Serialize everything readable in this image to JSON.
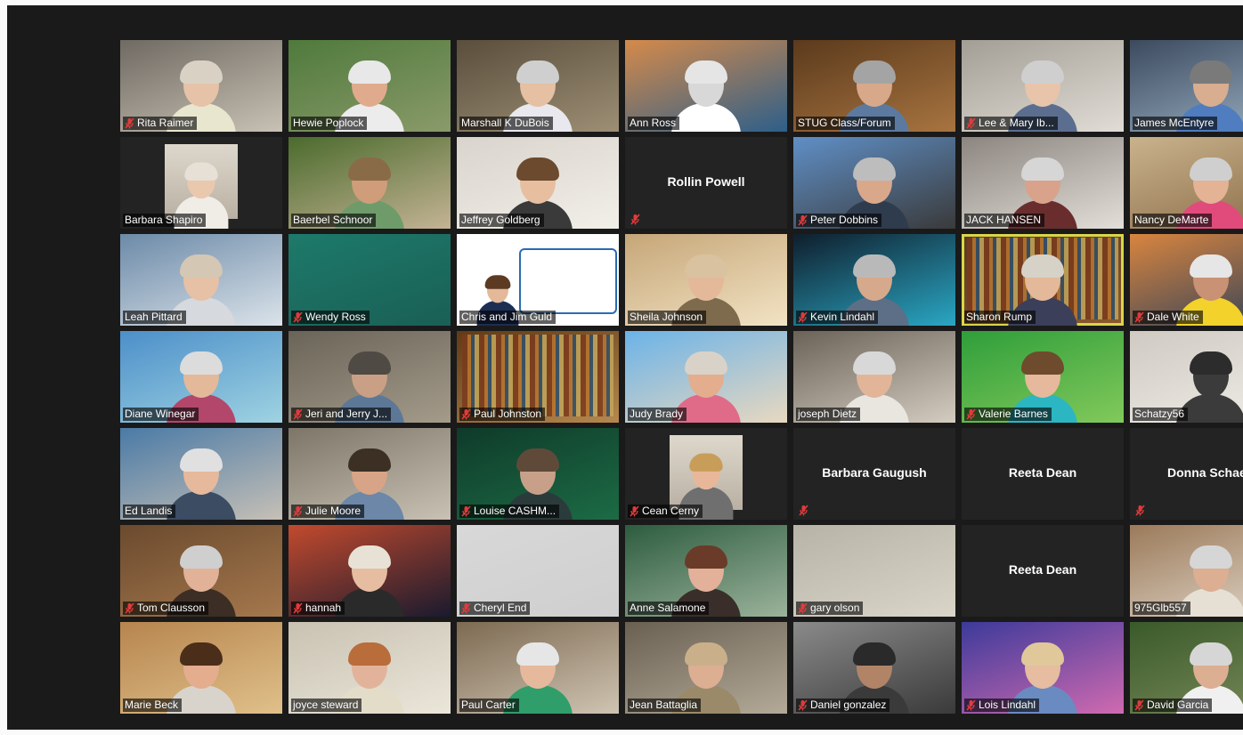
{
  "meeting": {
    "participants": [
      {
        "name": "Rita Raimer",
        "muted": true,
        "video": true,
        "c1": "#6f6a62",
        "c2": "#c8c1b4",
        "skin": "#e6c3a8",
        "hair": "#d9d2c4",
        "shirt": "#e9e6cf"
      },
      {
        "name": "Hewie Poplock",
        "muted": false,
        "video": true,
        "c1": "#4f7a3c",
        "c2": "#8a9a6a",
        "skin": "#e0ab8c",
        "hair": "#e8e8e8",
        "shirt": "#ececec"
      },
      {
        "name": "Marshall K DuBois",
        "muted": false,
        "video": true,
        "c1": "#5a4e3c",
        "c2": "#9d8f75",
        "skin": "#e5c0a2",
        "hair": "#cfcfcf",
        "shirt": "#e8e8ee"
      },
      {
        "name": "Ann Ross",
        "muted": false,
        "video": true,
        "c1": "#d58a4a",
        "c2": "#2d5f8a",
        "skin": "#d8d8d8",
        "hair": "#e5e5e5",
        "shirt": "#ffffff"
      },
      {
        "name": "STUG Class/Forum",
        "muted": false,
        "video": true,
        "c1": "#5b3a1c",
        "c2": "#a87440",
        "skin": "#d7a98a",
        "hair": "#a4a4a4",
        "shirt": "#5c7aa0"
      },
      {
        "name": "Lee & Mary Ib...",
        "muted": true,
        "video": true,
        "c1": "#a39e95",
        "c2": "#e1ddd6",
        "skin": "#e8c4aa",
        "hair": "#cfcfcf",
        "shirt": "#5b6e90"
      },
      {
        "name": "James McEntyre",
        "muted": false,
        "video": true,
        "c1": "#3c4a5e",
        "c2": "#9ab0c4",
        "skin": "#d9ad8f",
        "hair": "#7a7a7a",
        "shirt": "#4f7dbf"
      },
      {
        "name": "Barbara Shapiro",
        "muted": false,
        "video": false,
        "photo": true,
        "skin": "#e9c8ae",
        "hair": "#e6e0d6",
        "shirt": "#f0ece6"
      },
      {
        "name": "Baerbel Schnoor",
        "muted": false,
        "video": true,
        "c1": "#4b6b2d",
        "c2": "#c4b394",
        "skin": "#cf9d7a",
        "hair": "#8a6b48",
        "shirt": "#6f9b6b"
      },
      {
        "name": "Jeffrey Goldberg",
        "muted": false,
        "video": true,
        "c1": "#d9d4cc",
        "c2": "#f2efe9",
        "skin": "#e7be9f",
        "hair": "#6b4a2e",
        "shirt": "#3a3a3a"
      },
      {
        "name": "Rollin Powell",
        "muted": true,
        "video": false
      },
      {
        "name": "Peter Dobbins",
        "muted": true,
        "video": true,
        "c1": "#5f8fc6",
        "c2": "#3a3a3a",
        "skin": "#d9a88a",
        "hair": "#bdbdbd",
        "shirt": "#2f3c4e"
      },
      {
        "name": "JACK HANSEN",
        "muted": false,
        "video": true,
        "c1": "#8c8580",
        "c2": "#e3dfd8",
        "skin": "#d9a28a",
        "hair": "#d6d6d6",
        "shirt": "#6a2d2d"
      },
      {
        "name": "Nancy DeMarte",
        "muted": false,
        "video": true,
        "c1": "#c9b38c",
        "c2": "#8a6b48",
        "skin": "#e4b295",
        "hair": "#cfcfcf",
        "shirt": "#e04b7b"
      },
      {
        "name": "Leah Pittard",
        "muted": false,
        "video": true,
        "c1": "#6c8aa8",
        "c2": "#dbe3ea",
        "skin": "#e6c1a6",
        "hair": "#d4c7b4",
        "shirt": "#d6d9dd"
      },
      {
        "name": "Wendy Ross",
        "muted": true,
        "video": true,
        "c1": "#1d7a6a",
        "c2": "#1a5f56",
        "skin": "#1d7a6a",
        "hair": "#1d7a6a",
        "shirt": "#1d7a6a",
        "empty": true
      },
      {
        "name": "Chris and Jim  Guld",
        "muted": false,
        "video": true,
        "slide": true,
        "skin": "#e3b99a",
        "hair": "#5c3b22",
        "shirt": "#1d2e54"
      },
      {
        "name": "Sheila Johnson",
        "muted": false,
        "video": true,
        "c1": "#c6a678",
        "c2": "#f2e3c4",
        "skin": "#e3b99a",
        "hair": "#d9c2a0",
        "shirt": "#7e6a4c"
      },
      {
        "name": "Kevin Lindahl",
        "muted": true,
        "video": true,
        "c1": "#0f1e2c",
        "c2": "#2aa7c4",
        "skin": "#d6a98c",
        "hair": "#b9b9b9",
        "shirt": "#5c6f86"
      },
      {
        "name": "Sharon Rump",
        "muted": false,
        "video": true,
        "active": true,
        "bookshelf": true,
        "c1": "#5a3a1f",
        "c2": "#8c5a2e",
        "skin": "#e3b99a",
        "hair": "#d7d2c8",
        "shirt": "#3c3f59"
      },
      {
        "name": "Dale White",
        "muted": true,
        "video": true,
        "c1": "#d9853f",
        "c2": "#2b3f5a",
        "skin": "#c99274",
        "hair": "#e6e6e6",
        "shirt": "#f2d22b"
      },
      {
        "name": "Diane Winegar",
        "muted": false,
        "video": true,
        "c1": "#4c8fc9",
        "c2": "#9fd3e2",
        "skin": "#e3b99a",
        "hair": "#dcdcdc",
        "shirt": "#b2476b"
      },
      {
        "name": "Jeri and Jerry J...",
        "muted": true,
        "video": true,
        "c1": "#6a6458",
        "c2": "#a49b8a",
        "skin": "#c9a086",
        "hair": "#4f4a44",
        "shirt": "#5d7897"
      },
      {
        "name": "Paul Johnston",
        "muted": true,
        "video": true,
        "bookshelf": true,
        "c1": "#5f3a16",
        "c2": "#b5884e",
        "skin": "#a47d5e",
        "hair": "#5f3a16",
        "shirt": "#5f3a16",
        "empty": true
      },
      {
        "name": "Judy Brady",
        "muted": false,
        "video": true,
        "c1": "#6bb3e8",
        "c2": "#e8d8c0",
        "skin": "#e3ad8e",
        "hair": "#d9d2c8",
        "shirt": "#e06b89"
      },
      {
        "name": "joseph Dietz",
        "muted": false,
        "video": true,
        "c1": "#6b6358",
        "c2": "#d4ccc0",
        "skin": "#e2b599",
        "hair": "#d8d8d8",
        "shirt": "#e9e6e0"
      },
      {
        "name": "Valerie Barnes",
        "muted": true,
        "video": true,
        "c1": "#2f9e3a",
        "c2": "#82c95b",
        "skin": "#e6b99c",
        "hair": "#6e4b2c",
        "shirt": "#2bb6c2"
      },
      {
        "name": "Schatzy56",
        "muted": false,
        "video": true,
        "c1": "#cfcac2",
        "c2": "#f0ede8",
        "skin": "#3b3b3b",
        "hair": "#2c2c2c",
        "shirt": "#3b3b3b"
      },
      {
        "name": "Ed Landis",
        "muted": false,
        "video": true,
        "c1": "#4a7aa6",
        "c2": "#c6c0b6",
        "skin": "#e6b99c",
        "hair": "#e0e0e0",
        "shirt": "#3b4c63"
      },
      {
        "name": "Julie Moore",
        "muted": true,
        "video": true,
        "c1": "#7d7668",
        "c2": "#c9c2b4",
        "skin": "#d7a487",
        "hair": "#3c3025",
        "shirt": "#6c87a8"
      },
      {
        "name": "Louise CASHM...",
        "muted": true,
        "video": true,
        "c1": "#0f3b2a",
        "c2": "#1c6b45",
        "skin": "#c8a08a",
        "hair": "#5f4a3a",
        "shirt": "#2b3b3b"
      },
      {
        "name": "Cean Cerny",
        "muted": true,
        "video": false,
        "photo": true,
        "skin": "#e8b79a",
        "hair": "#c79d59",
        "shirt": "#6f6f6f"
      },
      {
        "name": "Barbara Gaugush",
        "muted": true,
        "video": false
      },
      {
        "name": "Reeta Dean",
        "muted": false,
        "video": false
      },
      {
        "name": "Donna Schaeff",
        "muted": true,
        "video": false
      },
      {
        "name": "Tom Clausson",
        "muted": true,
        "video": true,
        "c1": "#6b4a2e",
        "c2": "#a5784d",
        "skin": "#e2b298",
        "hair": "#cfcfcf",
        "shirt": "#3c2e24"
      },
      {
        "name": "hannah",
        "muted": true,
        "video": true,
        "c1": "#c24a2e",
        "c2": "#1a1a2e",
        "skin": "#e6bda0",
        "hair": "#e8e2d6",
        "shirt": "#2a2a2a"
      },
      {
        "name": "Cheryl End",
        "muted": true,
        "video": true,
        "c1": "#d8d8d8",
        "c2": "#cfcfcf",
        "skin": "#d8d8d8",
        "hair": "#d8d8d8",
        "shirt": "#d8d8d8",
        "empty": true
      },
      {
        "name": "Anne Salamone",
        "muted": false,
        "video": true,
        "c1": "#2d5c3f",
        "c2": "#9bb39b",
        "skin": "#e3b09a",
        "hair": "#6b3b2a",
        "shirt": "#3a2e2a"
      },
      {
        "name": "gary olson",
        "muted": true,
        "video": true,
        "c1": "#b7b3a6",
        "c2": "#d9d5c9",
        "skin": "#c7c3b6",
        "hair": "#c7c3b6",
        "shirt": "#c7c3b6",
        "empty": true
      },
      {
        "name": "Reeta Dean",
        "muted": false,
        "video": false
      },
      {
        "name": "975Glb557",
        "muted": false,
        "video": true,
        "c1": "#9b7a5a",
        "c2": "#e0d6c8",
        "skin": "#dcae92",
        "hair": "#d6d6d6",
        "shirt": "#e6e0d4"
      },
      {
        "name": "Marie Beck",
        "muted": false,
        "video": true,
        "c1": "#b7854e",
        "c2": "#e0c08a",
        "skin": "#e3ad8e",
        "hair": "#4a2e1a",
        "shirt": "#d8d4cc"
      },
      {
        "name": "joyce steward",
        "muted": false,
        "video": true,
        "c1": "#c9c2b2",
        "c2": "#ebe6da",
        "skin": "#e2b39a",
        "hair": "#b86d3a",
        "shirt": "#e2dcc9"
      },
      {
        "name": "Paul Carter",
        "muted": false,
        "video": true,
        "c1": "#7d6a52",
        "c2": "#cfc4b2",
        "skin": "#e6b99c",
        "hair": "#e6e6e6",
        "shirt": "#2f9e6a"
      },
      {
        "name": "Jean Battaglia",
        "muted": false,
        "video": true,
        "c1": "#6a6052",
        "c2": "#b4aa98",
        "skin": "#dcae92",
        "hair": "#c9b08a",
        "shirt": "#9a8a6a"
      },
      {
        "name": "Daniel gonzalez",
        "muted": true,
        "video": true,
        "c1": "#8a8a8a",
        "c2": "#3a3a3a",
        "skin": "#b18468",
        "hair": "#2a2a2a",
        "shirt": "#3a3a3a"
      },
      {
        "name": "Lois Lindahl",
        "muted": true,
        "video": true,
        "c1": "#3c3a9a",
        "c2": "#d06ab0",
        "skin": "#e6bda0",
        "hair": "#e0c89a",
        "shirt": "#6a8ac2"
      },
      {
        "name": "David Garcia",
        "muted": true,
        "video": true,
        "c1": "#3a5a2a",
        "c2": "#7a8a5a",
        "skin": "#dcae92",
        "hair": "#d6d6d6",
        "shirt": "#f0f0f0"
      }
    ]
  }
}
